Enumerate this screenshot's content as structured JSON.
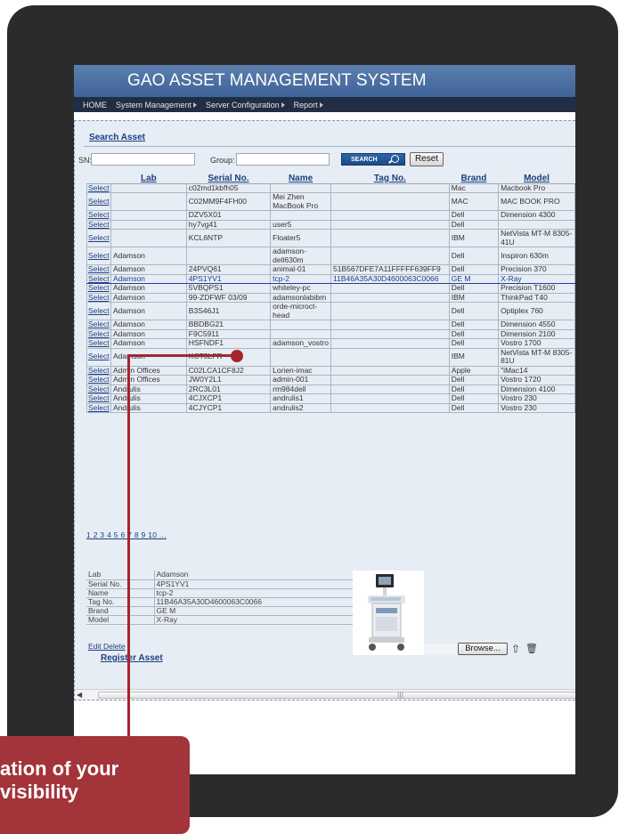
{
  "app": {
    "title": "GAO ASSET MANAGEMENT SYSTEM"
  },
  "menu": [
    {
      "label": "HOME"
    },
    {
      "label": "System Management"
    },
    {
      "label": "Server Configuration"
    },
    {
      "label": "Report"
    }
  ],
  "search": {
    "link": "Search Asset",
    "sn_label": "SN:",
    "sn_value": "",
    "group_label": "Group:",
    "group_value": "",
    "search_button": "SEARCH",
    "reset_button": "Reset"
  },
  "table": {
    "columns": [
      "Lab",
      "Serial No.",
      "Name",
      "Tag No.",
      "Brand",
      "Model"
    ],
    "select_label": "Select",
    "rows": [
      {
        "lab": "",
        "serial": "c02md1kbfh05",
        "name": "",
        "tag": "",
        "brand": "Mac",
        "model": "Macbook Pro",
        "h": 1
      },
      {
        "lab": "",
        "serial": "C02MM9F4FH00",
        "name": "Mei Zhen MacBook Pro",
        "tag": "",
        "brand": "MAC",
        "model": "MAC BOOK PRO",
        "h": 2
      },
      {
        "lab": "",
        "serial": "DZV5X01",
        "name": "",
        "tag": "",
        "brand": "Dell",
        "model": "Dimension 4300",
        "h": 1
      },
      {
        "lab": "",
        "serial": "hy7vg41",
        "name": "user5",
        "tag": "",
        "brand": "Dell",
        "model": "",
        "h": 1
      },
      {
        "lab": "",
        "serial": "KCL6NTP",
        "name": "Floater5",
        "tag": "",
        "brand": "IBM",
        "model": "NetVista MT-M 8305-41U",
        "h": 2
      },
      {
        "lab": "Adamson",
        "serial": "",
        "name": "adamson-dell630m",
        "tag": "",
        "brand": "Dell",
        "model": "Inspiron 630m",
        "h": 2
      },
      {
        "lab": "Adamson",
        "serial": "24PVQ61",
        "name": "animal-01",
        "tag": "51B567DFE7A11FFFFF639FF9",
        "brand": "Dell",
        "model": "Precision 370",
        "h": 1
      },
      {
        "lab": "Adamson",
        "serial": "4PS1YV1",
        "name": "tcp-2",
        "tag": "11B46A35A30D4600063C0066",
        "brand": "GE M",
        "model": "X-Ray",
        "h": 1,
        "hl": true
      },
      {
        "lab": "Adamson",
        "serial": "5VBQPS1",
        "name": "whiteley-pc",
        "tag": "",
        "brand": "Dell",
        "model": "Precision T1600",
        "h": 1
      },
      {
        "lab": "Adamson",
        "serial": "99-ZDFWF 03/09",
        "name": "adamsonlabibm",
        "tag": "",
        "brand": "IBM",
        "model": "ThinkPad T40",
        "h": 1
      },
      {
        "lab": "Adamson",
        "serial": "B3S46J1",
        "name": "orde-microct-head",
        "tag": "",
        "brand": "Dell",
        "model": "Optiplex 760",
        "h": 2
      },
      {
        "lab": "Adamson",
        "serial": "BBDBG21",
        "name": "",
        "tag": "",
        "brand": "Dell",
        "model": "Dimension 4550",
        "h": 1
      },
      {
        "lab": "Adamson",
        "serial": "F9C5911",
        "name": "",
        "tag": "",
        "brand": "Dell",
        "model": "Dimension 2100",
        "h": 1
      },
      {
        "lab": "Adamson",
        "serial": "HSFNDF1",
        "name": "adamson_vostro",
        "tag": "",
        "brand": "Dell",
        "model": "Vostro 1700",
        "h": 1
      },
      {
        "lab": "Adamson",
        "serial": "KCT3LFR",
        "name": "",
        "tag": "",
        "brand": "IBM",
        "model": "NetVista MT-M 8305-81U",
        "h": 2
      },
      {
        "lab": "Admin Offices",
        "serial": "C02LCA1CF8J2",
        "name": "Lorien-imac",
        "tag": "",
        "brand": "Apple",
        "model": "\"iMac14",
        "h": 1
      },
      {
        "lab": "Admin Offices",
        "serial": "JW0Y2L1",
        "name": "admin-001",
        "tag": "",
        "brand": "Dell",
        "model": "Vostro 1720",
        "h": 1
      },
      {
        "lab": "Andrulis",
        "serial": "2RC3L01",
        "name": "rm984dell",
        "tag": "",
        "brand": "Dell",
        "model": "Dimension 4100",
        "h": 1
      },
      {
        "lab": "Andrulis",
        "serial": "4CJXCP1",
        "name": "andrulis1",
        "tag": "",
        "brand": "Dell",
        "model": "Vostro 230",
        "h": 1
      },
      {
        "lab": "Andrulis",
        "serial": "4CJYCP1",
        "name": "andrulis2",
        "tag": "",
        "brand": "Dell",
        "model": "Vostro 230",
        "h": 1
      }
    ]
  },
  "pager": {
    "text": "1 2 3 4 5 6 7 8 9 10 ..."
  },
  "detail": {
    "rows": [
      {
        "k": "Lab",
        "v": "Adamson"
      },
      {
        "k": "Serial No.",
        "v": "4PS1YV1"
      },
      {
        "k": "Name",
        "v": "tcp-2"
      },
      {
        "k": "Tag No.",
        "v": "11B46A35A30D4600063C0066"
      },
      {
        "k": "Brand",
        "v": "GE M"
      },
      {
        "k": "Model",
        "v": "X-Ray"
      }
    ],
    "edit_label": "Edit",
    "delete_label": "Delete",
    "browse_button": "Browse...",
    "photo_icon": "ultrasound-machine-image",
    "upload_icon": "upload-icon",
    "delete_icon": "trash-icon"
  },
  "register": {
    "link": "Register Asset"
  },
  "callout": {
    "line1": "ation of your",
    "line2": "visibility",
    "color": "#a3343a"
  },
  "colors": {
    "header_blue": "#4a6fa5",
    "menu_dark": "#202d44",
    "link_blue": "#1d3f80"
  }
}
